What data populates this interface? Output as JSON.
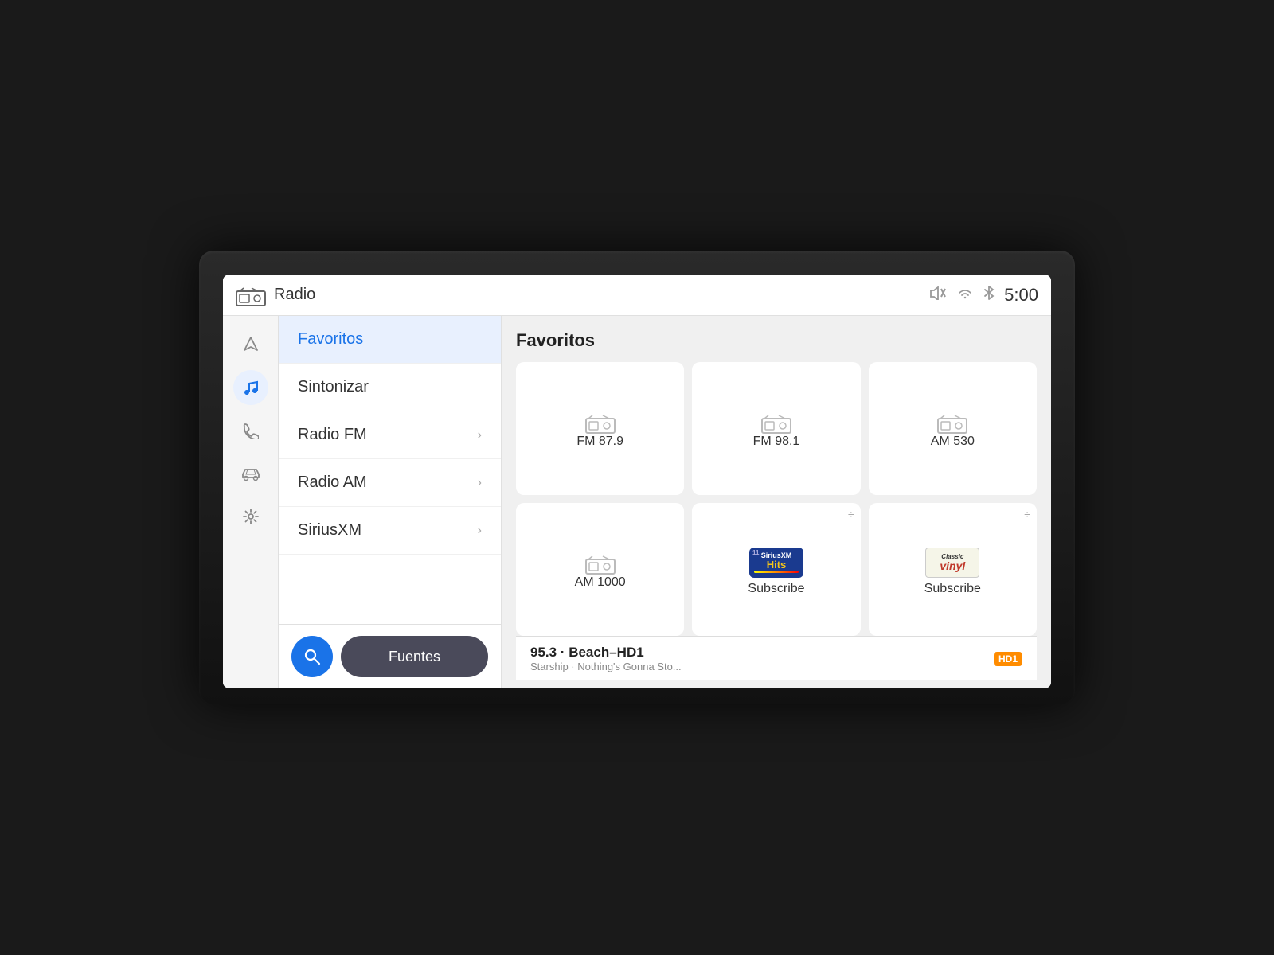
{
  "header": {
    "radio_label": "Radio",
    "clock": "5:00"
  },
  "status_icons": {
    "mute": "🔇",
    "wifi": "((·))",
    "bluetooth": "⚡"
  },
  "sidebar_icons": [
    {
      "name": "navigation",
      "symbol": "◁",
      "active": false
    },
    {
      "name": "music",
      "symbol": "♪",
      "active": true
    },
    {
      "name": "phone",
      "symbol": "☎",
      "active": false
    },
    {
      "name": "car",
      "symbol": "🚗",
      "active": false
    },
    {
      "name": "settings",
      "symbol": "⚙",
      "active": false
    }
  ],
  "nav_items": [
    {
      "id": "favoritos",
      "label": "Favoritos",
      "has_arrow": false,
      "selected": true
    },
    {
      "id": "sintonizar",
      "label": "Sintonizar",
      "has_arrow": false,
      "selected": false
    },
    {
      "id": "radio-fm",
      "label": "Radio FM",
      "has_arrow": true,
      "selected": false
    },
    {
      "id": "radio-am",
      "label": "Radio AM",
      "has_arrow": true,
      "selected": false
    },
    {
      "id": "siriusxm",
      "label": "SiriusXM",
      "has_arrow": true,
      "selected": false
    }
  ],
  "buttons": {
    "search_label": "🔍",
    "fuentes_label": "Fuentes"
  },
  "content": {
    "title": "Favoritos",
    "favorites": [
      {
        "id": "fm879",
        "label": "FM 87.9",
        "type": "radio",
        "has_pin": false
      },
      {
        "id": "fm981",
        "label": "FM 98.1",
        "type": "radio",
        "has_pin": false
      },
      {
        "id": "am530",
        "label": "AM 530",
        "type": "radio",
        "has_pin": false
      },
      {
        "id": "am1000",
        "label": "AM 1000",
        "type": "radio",
        "has_pin": false
      },
      {
        "id": "sirius-hits",
        "label": "Subscribe",
        "type": "sirius-hits",
        "has_pin": true
      },
      {
        "id": "classic-vinyl",
        "label": "Subscribe",
        "type": "classic-vinyl",
        "has_pin": true
      }
    ]
  },
  "now_playing": {
    "station": "95.3 · Beach–HD1",
    "track": "Starship · Nothing's Gonna Sto...",
    "hd_badge": "HD1"
  }
}
